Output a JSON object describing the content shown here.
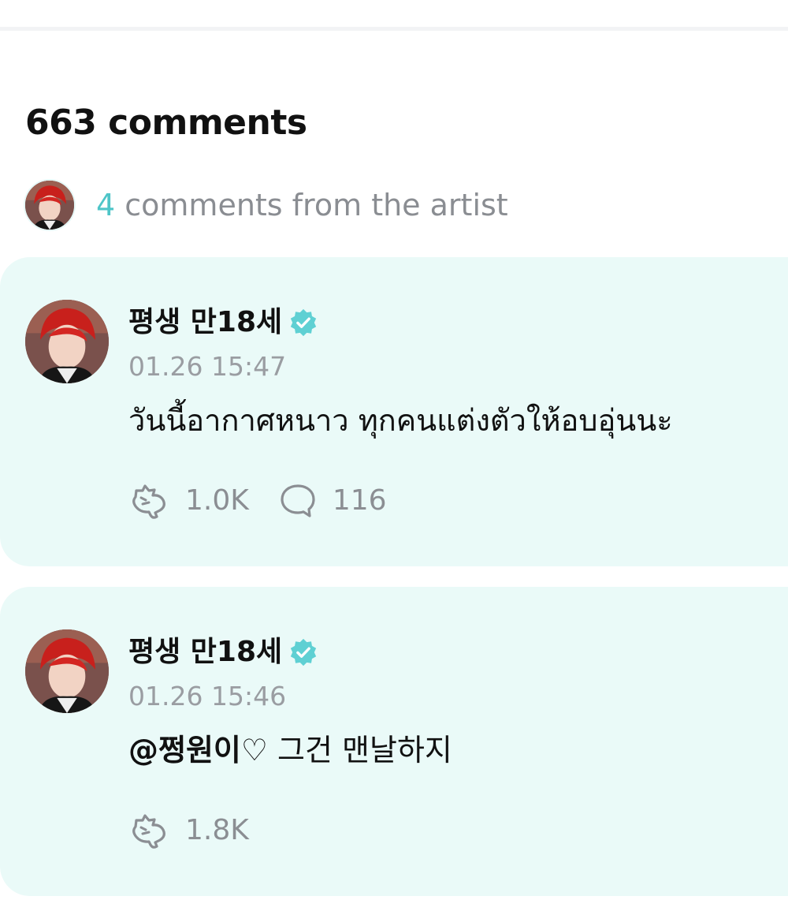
{
  "comments_header": {
    "count_label": "663 comments"
  },
  "artist_summary": {
    "count": "4",
    "label": " comments from the artist"
  },
  "comments": [
    {
      "author": "평생 만18세",
      "verified": true,
      "timestamp": "01.26 15:47",
      "mention": "",
      "text": "วันนี้อากาศหนาว ทุกคนแต่งตัวให้อบอุ่นนะ",
      "likes": "1.0K",
      "replies": "116"
    },
    {
      "author": "평생 만18세",
      "verified": true,
      "timestamp": "01.26 15:46",
      "mention": "@쩡원이♡",
      "text": " 그건 맨날하지",
      "likes": "1.8K",
      "replies": ""
    }
  ],
  "icons": {
    "like": "heart-hands-icon",
    "reply": "speech-bubble-icon",
    "verified": "verified-badge-icon"
  },
  "colors": {
    "accent": "#4ec5c8",
    "card_background": "#eafaf8",
    "muted_text": "#8b8e93"
  }
}
